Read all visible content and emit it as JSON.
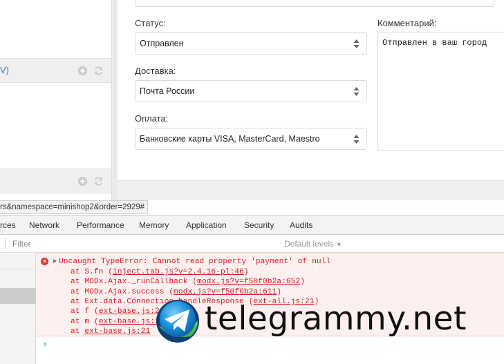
{
  "left_panel": {
    "row1_label": "V)",
    "icons": [
      "plus-circle-icon",
      "refresh-icon"
    ]
  },
  "form": {
    "status": {
      "label": "Статус:",
      "value": "Отправлен"
    },
    "delivery": {
      "label": "Доставка:",
      "value": "Почта России"
    },
    "payment": {
      "label": "Оплата:",
      "value": "Банковские карты VISA, MasterCard, Maestro"
    },
    "comment": {
      "label": "Комментарий:",
      "value": "Отправлен в ваш город"
    }
  },
  "url_tooltip": "rs&namespace=minishop2&order=2929#",
  "devtools": {
    "tabs": [
      "rces",
      "Network",
      "Performance",
      "Memory",
      "Application",
      "Security",
      "Audits"
    ],
    "filter_placeholder": "Filter",
    "levels_label": "Default levels",
    "error": {
      "message": "Uncaught TypeError: Cannot read property 'payment' of null",
      "stack": [
        {
          "prefix": "at S.fn (",
          "link": "inject.tab.js?v=2.4.16-pl:46",
          "suffix": ")"
        },
        {
          "prefix": "at MODx.Ajax._runCallback (",
          "link": "modx.js?v=f50f0b2a:652",
          "suffix": ")"
        },
        {
          "prefix": "at MODx.Ajax.success (",
          "link": "modx.js?v=f50f0b2a:611",
          "suffix": ")"
        },
        {
          "prefix": "at Ext.data.Connection.handleResponse (",
          "link": "ext-all.js:21",
          "suffix": ")"
        },
        {
          "prefix": "at f (",
          "link": "ext-base.js:21",
          "suffix": ")"
        },
        {
          "prefix": "at m (",
          "link": "ext-base.js:21",
          "suffix": ")"
        },
        {
          "prefix": "at ",
          "link": "ext-base.js:21",
          "suffix": ""
        }
      ]
    },
    "prompt": "›"
  },
  "watermark": {
    "text": "telegrammy.net",
    "icon": "telegram-logo-icon"
  },
  "colors": {
    "error_text": "#e02020",
    "error_bg": "#fff0f0",
    "link_blue": "#3a7cc1"
  }
}
